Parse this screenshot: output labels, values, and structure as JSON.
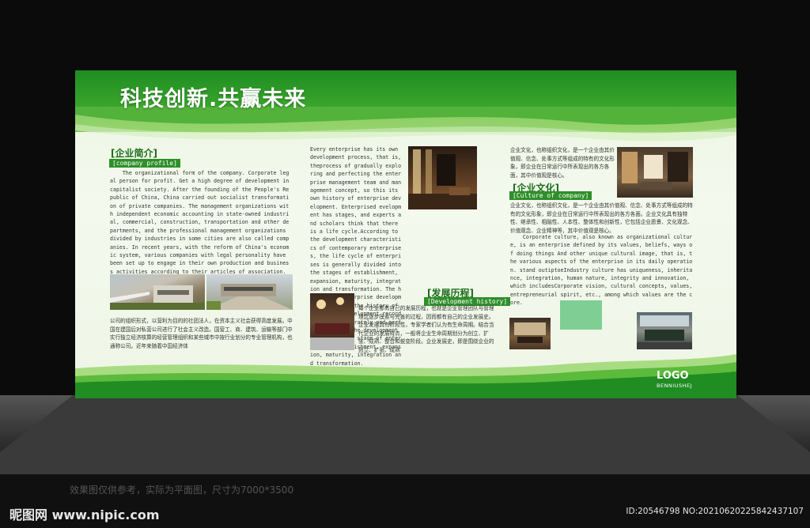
{
  "board": {
    "title": "科技创新.共赢未来",
    "logo": "LOGO",
    "logo_sub": "BENNIUSHEJ"
  },
  "profile": {
    "heading": "[企业简介]",
    "tag": "[company profile]",
    "english": "    The organizational form of the company. Corporate legal person for profit. Get a high degree of development in capitalist society. After the founding of the People's Republic of China, China carried out socialist transformation of private companies. The management organizations with independent economic accounting in state-owned industrial, commercial, construction, transportation and other departments, and the professional management organizations divided by industries in some cities are also called companies. In recent years, with the reform of China's economic system, various companies with legal personality have been set up to engage in their own production and business activities according to their articles of association.",
    "chinese": "公司的组织形式，以营利为目的的社团法人，在资本主义社会获得高度发展。中国在建国后对私营公司进行了社会主义改造。国营工、商、建筑、运输等部门中实行独立经济核算的经营管理组织和某些城市中按行业划分的专业管理机构，也通称公司。近年来随着中国经济体"
  },
  "middle": {
    "english": "Every enterprise has its own development process, that is, theprocess of gradually exploring and perfecting the enterprise management team and management concept, so this its own history of enterprise development. Enterprised evelopment has stages, and experts and scholars think that there is a life cycle.According to the development characteristics of contemporary enterprises, the life cycle of enterprises is generally divided into the stages of establishment, expansion, maturity, integration and transformation. The history of enterprise development, that is, the history of enterprise development recorded truly, accurately and perfectly around the development status of each stage of enterprise's establishment, expansion, maturity, integration and transformation.",
    "heading": "[发展历程]",
    "tag": "[Development history]",
    "chinese": "每个企业都有自己的发展历程，也就是企业管理团队与管理理念逐步摸索与完善的过程，因而都有自己的企业发展史。企业发展具有阶段性，专家学者们认为有生命周期。结合当代企业的发展特点，一般将企业生命周期划分为创立、扩张、成熟、整合和蜕变阶段。企业发展史，即是围绕企业的创立、扩张、成熟"
  },
  "culture": {
    "intro_cn": "企业文化，也称组织文化，是一个企业由其价值观、信念、处事方式等组成的特有的文化形象，即企业在日常运行中所表现出的各方各面，其中价值观是核心。",
    "heading": "[企业文化]",
    "tag": "[Culture of company]",
    "body_cn": "企业文化，也称组织文化，是一个企业由其价值观、信念、处事方式等组成的特有的文化形象，即企业在日常运行中所表现出的各方各面。企业文化具有独特性、继承性、相融性、人本性、整体性和创新性，它包括企业愿景、文化观念、价值观念、企业精神等，其中价值观是核心。",
    "english": "    Corporate culture, also known as organizational culture, is an enterprise defined by its values, beliefs, ways of doing things And other unique cultural image, that is, the various aspects of the enterprise in its daily operation. stand outiptoeIndustry culture has uniqueness, inheritance, integration, human nature, integrity and innovation, which includesCorporate vision, cultural concepts, values, entrepreneurial spirit, etc., among which values are the core."
  },
  "caption": "效果图仅供参考，实际为平面图，尺寸为7000*3500",
  "watermark": {
    "site": "昵图网 www.nipic.com",
    "id": "ID:20546798 NO:20210620225842437107"
  }
}
